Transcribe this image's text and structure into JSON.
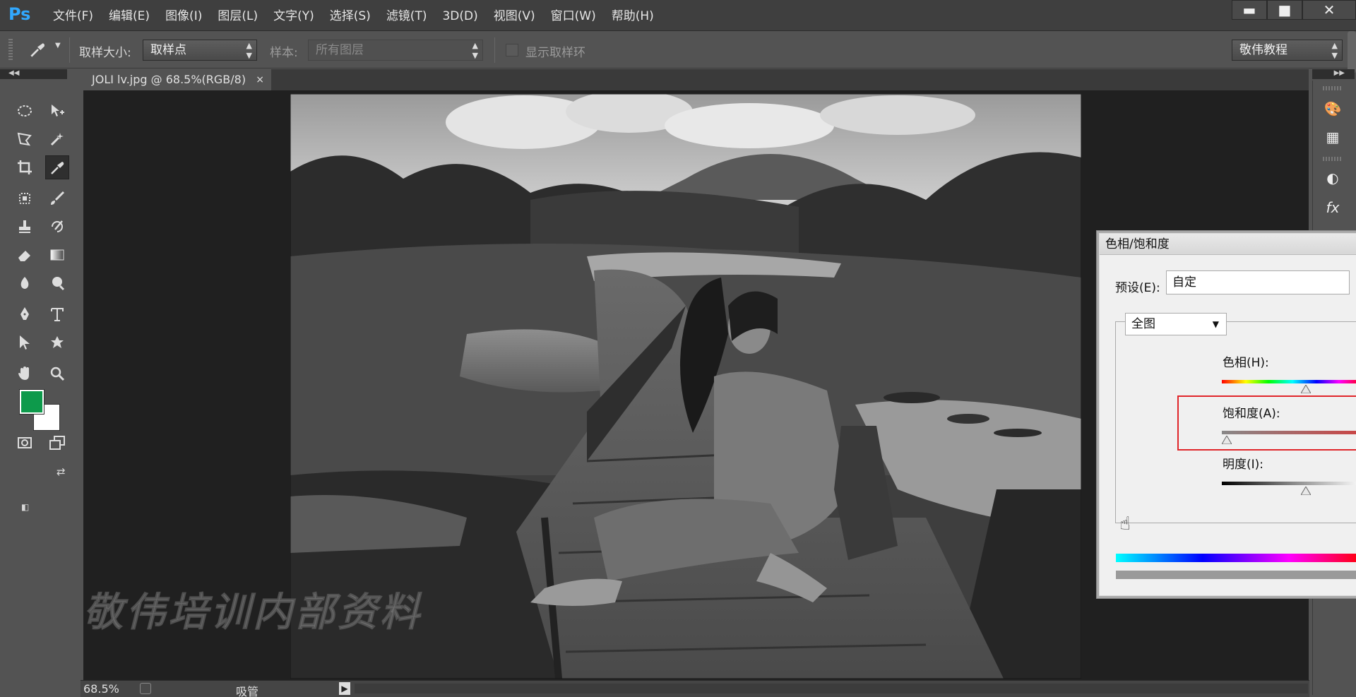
{
  "app": {
    "logo": "Ps"
  },
  "menu": [
    "文件(F)",
    "编辑(E)",
    "图像(I)",
    "图层(L)",
    "文字(Y)",
    "选择(S)",
    "滤镜(T)",
    "3D(D)",
    "视图(V)",
    "窗口(W)",
    "帮助(H)"
  ],
  "window_controls": {
    "minimize": "▬",
    "maximize": "■",
    "close": "✕"
  },
  "options": {
    "sample_size_label": "取样大小:",
    "sample_size_value": "取样点",
    "sample_label": "样本:",
    "sample_value": "所有图层",
    "show_ring_label": "显示取样环",
    "workspace": "敬伟教程"
  },
  "document": {
    "tab": "JOLI lv.jpg @ 68.5%(RGB/8)",
    "tab_close": "×",
    "watermark": "敬伟培训内部资料"
  },
  "status": {
    "zoom": "68.5%",
    "info": "吸管",
    "arrow": "▶"
  },
  "colors": {
    "foreground": "#0d9a4b",
    "background": "#ffffff",
    "highlight": "#e0262a"
  },
  "dialog": {
    "title": "色相/饱和度",
    "preset_label": "预设(E):",
    "preset_value": "自定",
    "channel": "全图",
    "hue_label": "色相(H):",
    "saturation_label": "饱和度(A):",
    "lightness_label": "明度(I):",
    "hue_value_fraction": 0.6,
    "saturation_value_fraction": 0.0,
    "lightness_value_fraction": 0.6
  }
}
